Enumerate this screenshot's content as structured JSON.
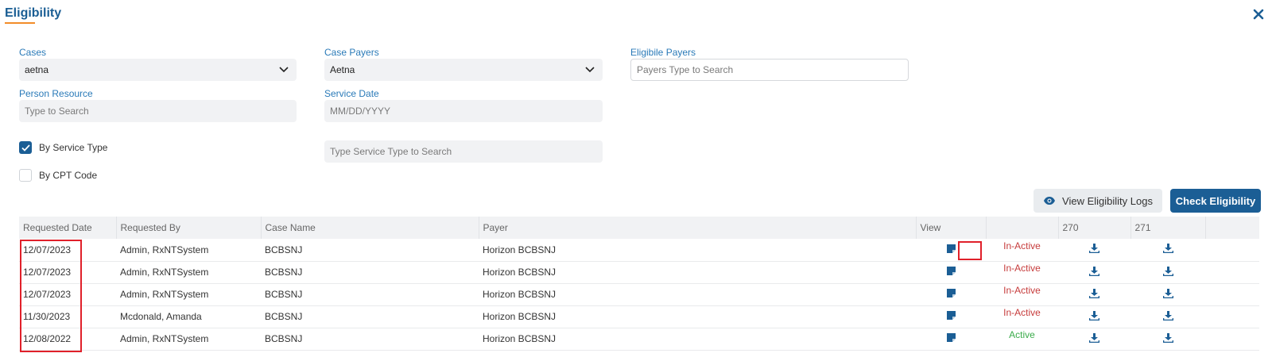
{
  "header": {
    "title": "Eligibility"
  },
  "form": {
    "cases": {
      "label": "Cases",
      "value": "aetna"
    },
    "case_payers": {
      "label": "Case Payers",
      "value": "Aetna"
    },
    "eligible_payers": {
      "label": "Eligibile Payers",
      "placeholder": "Payers Type to Search"
    },
    "person_resource": {
      "label": "Person Resource",
      "placeholder": "Type to Search"
    },
    "service_date": {
      "label": "Service Date",
      "placeholder": "MM/DD/YYYY"
    },
    "by_service_type": {
      "label": "By Service Type",
      "checked": true
    },
    "by_cpt_code": {
      "label": "By CPT Code",
      "checked": false
    },
    "service_type_search": {
      "placeholder": "Type Service Type to Search"
    }
  },
  "actions": {
    "view_logs_label": "View Eligibility Logs",
    "check_label": "Check Eligibility"
  },
  "table": {
    "headers": [
      "Requested Date",
      "Requested By",
      "Case Name",
      "Payer",
      "View",
      "",
      "270",
      "271"
    ],
    "rows": [
      {
        "date": "12/07/2023",
        "by": "Admin, RxNTSystem",
        "case": "BCBSNJ",
        "payer": "Horizon BCBSNJ",
        "status": "In-Active"
      },
      {
        "date": "12/07/2023",
        "by": "Admin, RxNTSystem",
        "case": "BCBSNJ",
        "payer": "Horizon BCBSNJ",
        "status": "In-Active"
      },
      {
        "date": "12/07/2023",
        "by": "Admin, RxNTSystem",
        "case": "BCBSNJ",
        "payer": "Horizon BCBSNJ",
        "status": "In-Active"
      },
      {
        "date": "11/30/2023",
        "by": "Mcdonald, Amanda",
        "case": "BCBSNJ",
        "payer": "Horizon BCBSNJ",
        "status": "In-Active"
      },
      {
        "date": "12/08/2022",
        "by": "Admin, RxNTSystem",
        "case": "BCBSNJ",
        "payer": "Horizon BCBSNJ",
        "status": "Active"
      }
    ]
  },
  "icons": {
    "close": "close-icon",
    "dropdown": "chevron-down-icon",
    "eye": "eye-icon",
    "view": "document-icon",
    "download": "download-icon",
    "check": "checkmark-icon"
  },
  "colors": {
    "primary": "#1b5e95",
    "label": "#2a7ab8",
    "accent_underline": "#f28c28",
    "inactive": "#c63b3b",
    "active": "#3aab4a",
    "highlight": "#e0202a"
  }
}
